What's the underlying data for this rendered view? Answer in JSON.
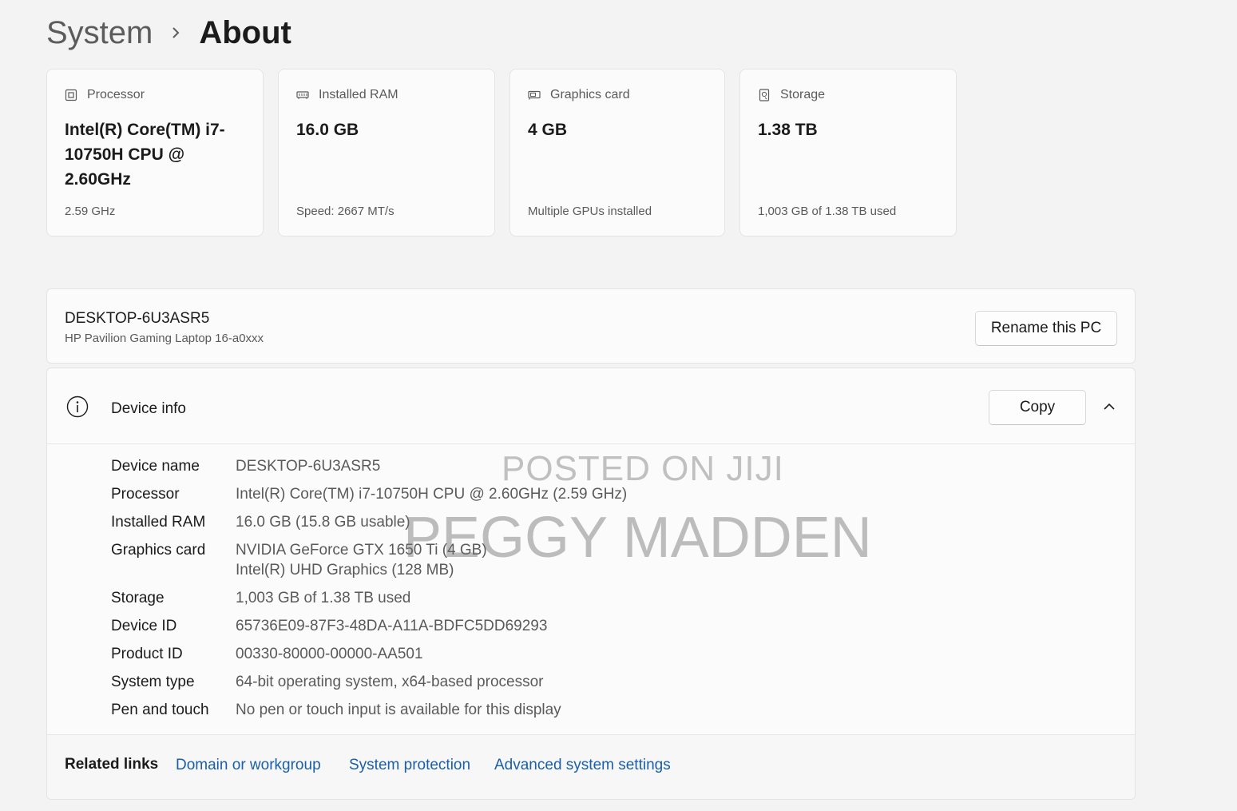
{
  "breadcrumb": {
    "parent": "System",
    "current": "About"
  },
  "specs": [
    {
      "icon": "processor-icon",
      "label": "Processor",
      "value": "Intel(R) Core(TM) i7-10750H CPU @ 2.60GHz",
      "sub": "2.59 GHz"
    },
    {
      "icon": "ram-icon",
      "label": "Installed RAM",
      "value": "16.0 GB",
      "sub": "Speed: 2667 MT/s"
    },
    {
      "icon": "graphics-card-icon",
      "label": "Graphics card",
      "value": "4 GB",
      "sub": "Multiple GPUs installed"
    },
    {
      "icon": "storage-icon",
      "label": "Storage",
      "value": "1.38 TB",
      "sub": "1,003 GB of 1.38 TB used"
    }
  ],
  "pc": {
    "name": "DESKTOP-6U3ASR5",
    "model": "HP Pavilion Gaming Laptop 16-a0xxx",
    "rename_label": "Rename this PC"
  },
  "device_info": {
    "title": "Device info",
    "copy_label": "Copy",
    "rows": [
      {
        "key": "Device name",
        "value": "DESKTOP-6U3ASR5"
      },
      {
        "key": "Processor",
        "value": "Intel(R) Core(TM) i7-10750H CPU @ 2.60GHz (2.59 GHz)"
      },
      {
        "key": "Installed RAM",
        "value": "16.0 GB (15.8 GB usable)"
      },
      {
        "key": "Graphics card",
        "value": "NVIDIA GeForce GTX 1650 Ti (4 GB)",
        "value2": "Intel(R) UHD Graphics (128 MB)"
      },
      {
        "key": "Storage",
        "value": "1,003 GB of 1.38 TB used"
      },
      {
        "key": "Device ID",
        "value": "65736E09-87F3-48DA-A11A-BDFC5DD69293"
      },
      {
        "key": "Product ID",
        "value": "00330-80000-00000-AA501"
      },
      {
        "key": "System type",
        "value": "64-bit operating system, x64-based processor"
      },
      {
        "key": "Pen and touch",
        "value": "No pen or touch input is available for this display"
      }
    ]
  },
  "related": {
    "label": "Related links",
    "links": [
      "Domain or workgroup",
      "System protection",
      "Advanced system settings"
    ]
  },
  "watermark": {
    "line1": "POSTED ON JIJI",
    "line2": "PEGGY MADDEN"
  }
}
